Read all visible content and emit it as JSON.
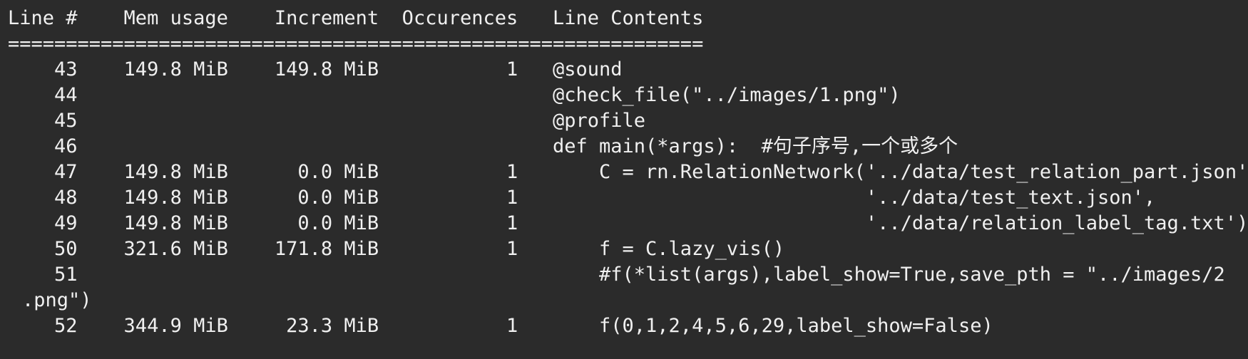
{
  "header": {
    "columns": "Line #    Mem usage    Increment  Occurences   Line Contents",
    "separator": "============================================================"
  },
  "rows": [
    {
      "text": "    43    149.8 MiB    149.8 MiB           1   @sound"
    },
    {
      "text": "    44                                         @check_file(\"../images/1.png\")"
    },
    {
      "text": "    45                                         @profile"
    },
    {
      "text": "    46                                         def main(*args):  #句子序号,一个或多个"
    },
    {
      "text": "    47    149.8 MiB      0.0 MiB           1       C = rn.RelationNetwork('../data/test_relation_part.json',"
    },
    {
      "text": "    48    149.8 MiB      0.0 MiB           1                              '../data/test_text.json',"
    },
    {
      "text": "    49    149.8 MiB      0.0 MiB           1                              '../data/relation_label_tag.txt')"
    },
    {
      "text": "    50    321.6 MiB    171.8 MiB           1       f = C.lazy_vis()"
    },
    {
      "text": "    51                                             #f(*list(args),label_show=True,save_pth = \"../images/2"
    },
    {
      "text": ".png\")"
    },
    {
      "text": "    52    344.9 MiB     23.3 MiB           1       f(0,1,2,4,5,6,29,label_show=False)"
    }
  ]
}
